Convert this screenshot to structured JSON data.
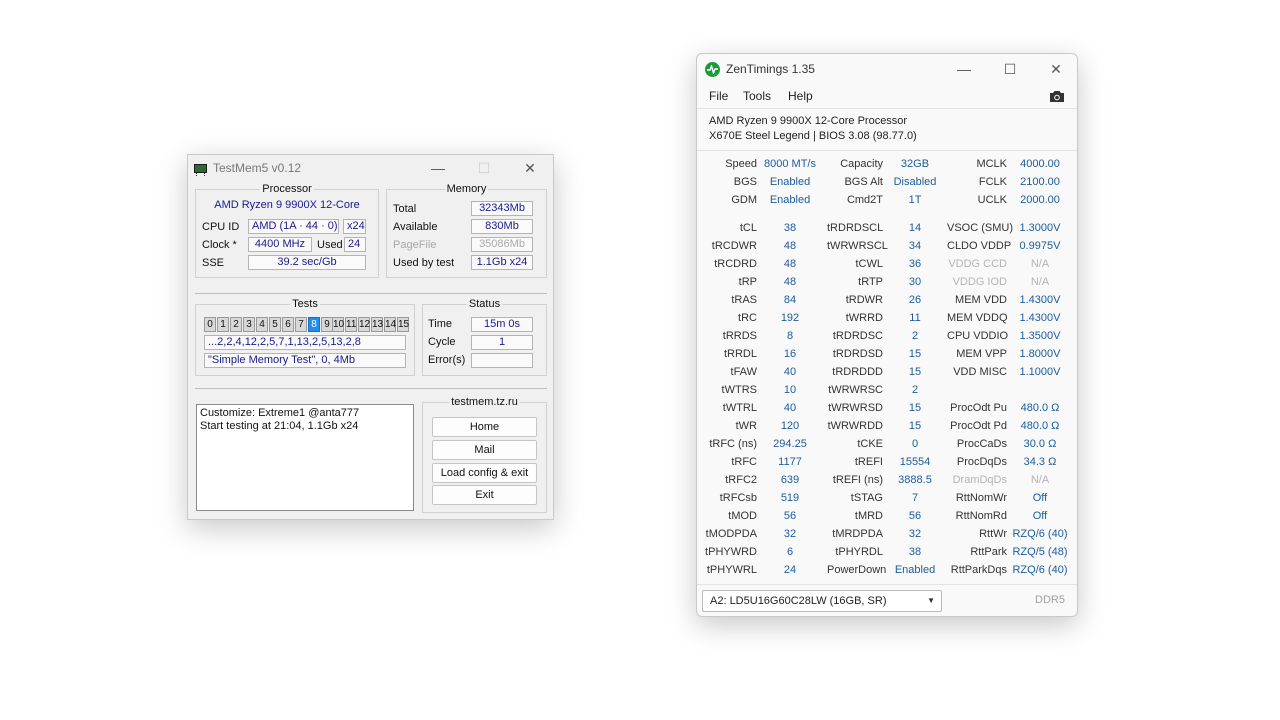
{
  "testmem": {
    "title": "TestMem5 v0.12",
    "processor": {
      "title": "Processor",
      "cpu_name": "AMD Ryzen 9 9900X 12-Core",
      "cpuid_label": "CPU ID",
      "cpuid_value": "AMD  (1A · 44 · 0)",
      "cpuid_threads": "x24",
      "clock_label": "Clock *",
      "clock_value": "4400 MHz",
      "used_label": "Used",
      "used_value": "24",
      "sse_label": "SSE",
      "sse_value": "39.2 sec/Gb"
    },
    "memory": {
      "title": "Memory",
      "total_label": "Total",
      "total_value": "32343Mb",
      "available_label": "Available",
      "available_value": "830Mb",
      "pagefile_label": "PageFile",
      "pagefile_value": "35086Mb",
      "usedbytest_label": "Used by test",
      "usedbytest_value": "1.1Gb x24"
    },
    "tests": {
      "title": "Tests",
      "numbers": [
        "0",
        "1",
        "2",
        "3",
        "4",
        "5",
        "6",
        "7",
        "8",
        "9",
        "10",
        "11",
        "12",
        "13",
        "14",
        "15"
      ],
      "active_index": 8,
      "sequence": "...2,2,4,12,2,5,7,1,13,2,5,13,2,8",
      "current_test": "\"Simple Memory Test\", 0, 4Mb"
    },
    "status": {
      "title": "Status",
      "time_label": "Time",
      "time_value": "15m 0s",
      "cycle_label": "Cycle",
      "cycle_value": "1",
      "errors_label": "Error(s)",
      "errors_value": ""
    },
    "log": {
      "line1": "Customize: Extreme1 @anta777",
      "line2": "Start testing at 21:04, 1.1Gb x24"
    },
    "site": {
      "title": "testmem.tz.ru",
      "home": "Home",
      "mail": "Mail",
      "load": "Load config & exit",
      "exit": "Exit"
    }
  },
  "zentimings": {
    "title": "ZenTimings 1.35",
    "menu": {
      "file": "File",
      "tools": "Tools",
      "help": "Help"
    },
    "cpu": "AMD Ryzen 9 9900X 12-Core Processor",
    "board": "X670E Steel Legend | BIOS 3.08 (98.77.0)",
    "top_rows": [
      [
        "Speed",
        "8000 MT/s",
        "Capacity",
        "32GB",
        "MCLK",
        "4000.00"
      ],
      [
        "BGS",
        "Enabled",
        "BGS Alt",
        "Disabled",
        "FCLK",
        "2100.00"
      ],
      [
        "GDM",
        "Enabled",
        "Cmd2T",
        "1T",
        "UCLK",
        "2000.00"
      ]
    ],
    "timing_rows": [
      [
        "tCL",
        "38",
        "tRDRDSCL",
        "14",
        "VSOC (SMU)",
        "1.3000V"
      ],
      [
        "tRCDWR",
        "48",
        "tWRWRSCL",
        "34",
        "CLDO VDDP",
        "0.9975V"
      ],
      [
        "tRCDRD",
        "48",
        "tCWL",
        "36",
        "VDDG CCD",
        "N/A"
      ],
      [
        "tRP",
        "48",
        "tRTP",
        "30",
        "VDDG IOD",
        "N/A"
      ],
      [
        "tRAS",
        "84",
        "tRDWR",
        "26",
        "MEM VDD",
        "1.4300V"
      ],
      [
        "tRC",
        "192",
        "tWRRD",
        "11",
        "MEM VDDQ",
        "1.4300V"
      ],
      [
        "tRRDS",
        "8",
        "tRDRDSC",
        "2",
        "CPU VDDIO",
        "1.3500V"
      ],
      [
        "tRRDL",
        "16",
        "tRDRDSD",
        "15",
        "MEM VPP",
        "1.8000V"
      ],
      [
        "tFAW",
        "40",
        "tRDRDDD",
        "15",
        "VDD MISC",
        "1.1000V"
      ],
      [
        "tWTRS",
        "10",
        "tWRWRSC",
        "2",
        "",
        ""
      ],
      [
        "tWTRL",
        "40",
        "tWRWRSD",
        "15",
        "ProcOdt Pu",
        "480.0 Ω"
      ],
      [
        "tWR",
        "120",
        "tWRWRDD",
        "15",
        "ProcOdt Pd",
        "480.0 Ω"
      ],
      [
        "tRFC (ns)",
        "294.25",
        "tCKE",
        "0",
        "ProcCaDs",
        "30.0 Ω"
      ],
      [
        "tRFC",
        "1177",
        "tREFI",
        "15554",
        "ProcDqDs",
        "34.3 Ω"
      ],
      [
        "tRFC2",
        "639",
        "tREFI (ns)",
        "3888.5",
        "DramDqDs",
        "N/A"
      ],
      [
        "tRFCsb",
        "519",
        "tSTAG",
        "7",
        "RttNomWr",
        "Off"
      ],
      [
        "tMOD",
        "56",
        "tMRD",
        "56",
        "RttNomRd",
        "Off"
      ],
      [
        "tMODPDA",
        "32",
        "tMRDPDA",
        "32",
        "RttWr",
        "RZQ/6 (40)"
      ],
      [
        "tPHYWRD",
        "6",
        "tPHYRDL",
        "38",
        "RttPark",
        "RZQ/5 (48)"
      ],
      [
        "tPHYWRL",
        "24",
        "PowerDown",
        "Enabled",
        "RttParkDqs",
        "RZQ/6 (40)"
      ]
    ],
    "greyed": [
      "VDDG CCD",
      "VDDG IOD",
      "DramDqDs"
    ],
    "dimm_select": "A2: LD5U16G60C28LW (16GB, SR)",
    "mem_type": "DDR5"
  }
}
